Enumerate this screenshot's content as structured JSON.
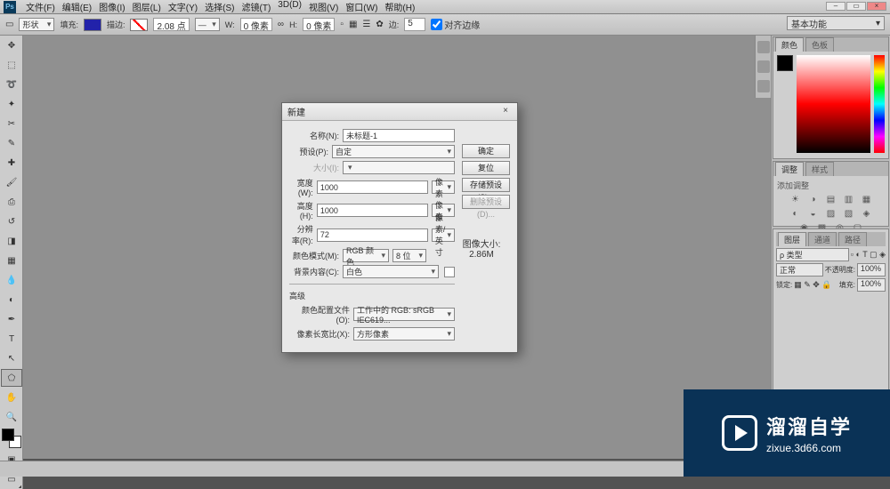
{
  "menubar": {
    "items": [
      "文件(F)",
      "编辑(E)",
      "图像(I)",
      "图层(L)",
      "文字(Y)",
      "选择(S)",
      "滤镜(T)",
      "3D(D)",
      "视图(V)",
      "窗口(W)",
      "帮助(H)"
    ]
  },
  "workflow_label": "基本功能",
  "options_bar": {
    "shape": "形状",
    "fill": "填充:",
    "stroke": "描边:",
    "stroke_pt": "2.08 点",
    "w": "W:",
    "w_val": "0 像素",
    "link": "∞",
    "h": "H:",
    "h_val": "0 像素",
    "side": "边:",
    "side_val": "5",
    "align_edges": "对齐边缘"
  },
  "tools": [
    "move",
    "rect-marquee",
    "lasso",
    "magic-wand",
    "crop",
    "eyedropper",
    "healing",
    "brush",
    "stamp",
    "history-brush",
    "eraser",
    "gradient",
    "blur",
    "dodge",
    "pen",
    "type",
    "path-select",
    "rectangle",
    "hand",
    "zoom"
  ],
  "panels": {
    "color_tabs": [
      "颜色",
      "色板"
    ],
    "adjust_tabs": [
      "调整",
      "样式"
    ],
    "adjust_hint": "添加调整",
    "layers_tabs": [
      "图层",
      "通道",
      "路径"
    ],
    "layers": {
      "kind": "ρ 类型",
      "mode": "正常",
      "opacity_label": "不透明度:",
      "opacity": "100%",
      "lock": "锁定:",
      "fill_label": "填充:",
      "fill": "100%"
    }
  },
  "dialog": {
    "title": "新建",
    "name_label": "名称(N):",
    "name_value": "未标题-1",
    "preset_label": "预设(P):",
    "preset_value": "自定",
    "size_label": "大小(I):",
    "width_label": "宽度(W):",
    "width_value": "1000",
    "width_unit": "像素",
    "height_label": "高度(H):",
    "height_value": "1000",
    "height_unit": "像素",
    "res_label": "分辨率(R):",
    "res_value": "72",
    "res_unit": "像素/英寸",
    "cmode_label": "颜色模式(M):",
    "cmode_value": "RGB 颜色",
    "cdepth_value": "8 位",
    "bg_label": "背景内容(C):",
    "bg_value": "白色",
    "advanced": "高级",
    "profile_label": "颜色配置文件(O):",
    "profile_value": "工作中的 RGB: sRGB IEC619...",
    "aspect_label": "像素长宽比(X):",
    "aspect_value": "方形像素",
    "imgsize_label": "图像大小:",
    "imgsize_value": "2.86M",
    "buttons": {
      "ok": "确定",
      "cancel": "复位",
      "save_preset": "存储预设(S)...",
      "delete_preset": "删除预设(D)..."
    }
  },
  "watermark": {
    "zh": "溜溜自学",
    "url": "zixue.3d66.com"
  }
}
